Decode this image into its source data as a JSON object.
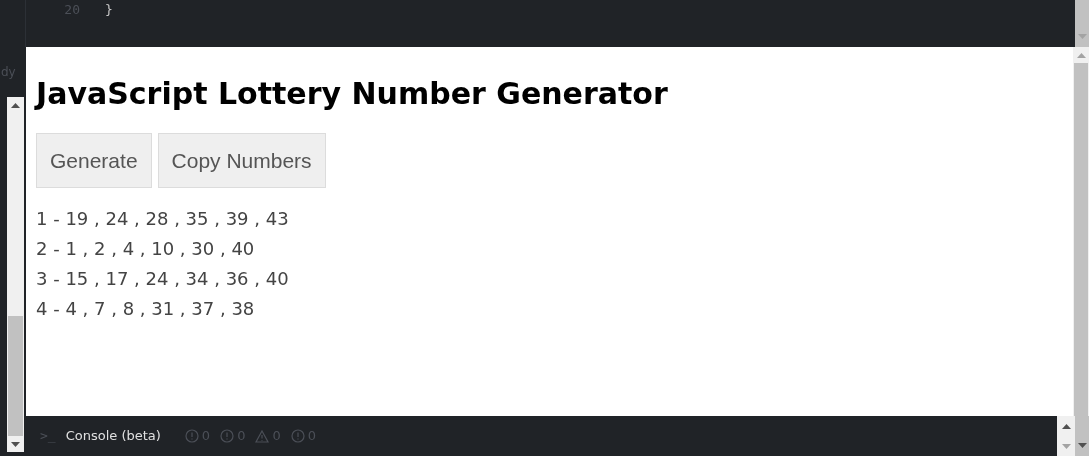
{
  "editor": {
    "line_number": "20",
    "code": "}"
  },
  "side_panel": {
    "label": "dy"
  },
  "preview": {
    "heading": "JavaScript Lottery Number Generator",
    "buttons": [
      "Generate",
      "Copy Numbers"
    ],
    "results": [
      "1 - 19 , 24 , 28 , 35 , 39 , 43",
      "2 - 1 , 2 , 4 , 10 , 30 , 40",
      "3 - 15 , 17 , 24 , 34 , 36 , 40",
      "4 - 4 , 7 , 8 , 31 , 37 , 38"
    ]
  },
  "console": {
    "prompt": ">_",
    "title": "Console (beta)",
    "counters": [
      {
        "kind": "error",
        "count": "0"
      },
      {
        "kind": "info",
        "count": "0"
      },
      {
        "kind": "warning",
        "count": "0"
      },
      {
        "kind": "log",
        "count": "0"
      }
    ]
  }
}
